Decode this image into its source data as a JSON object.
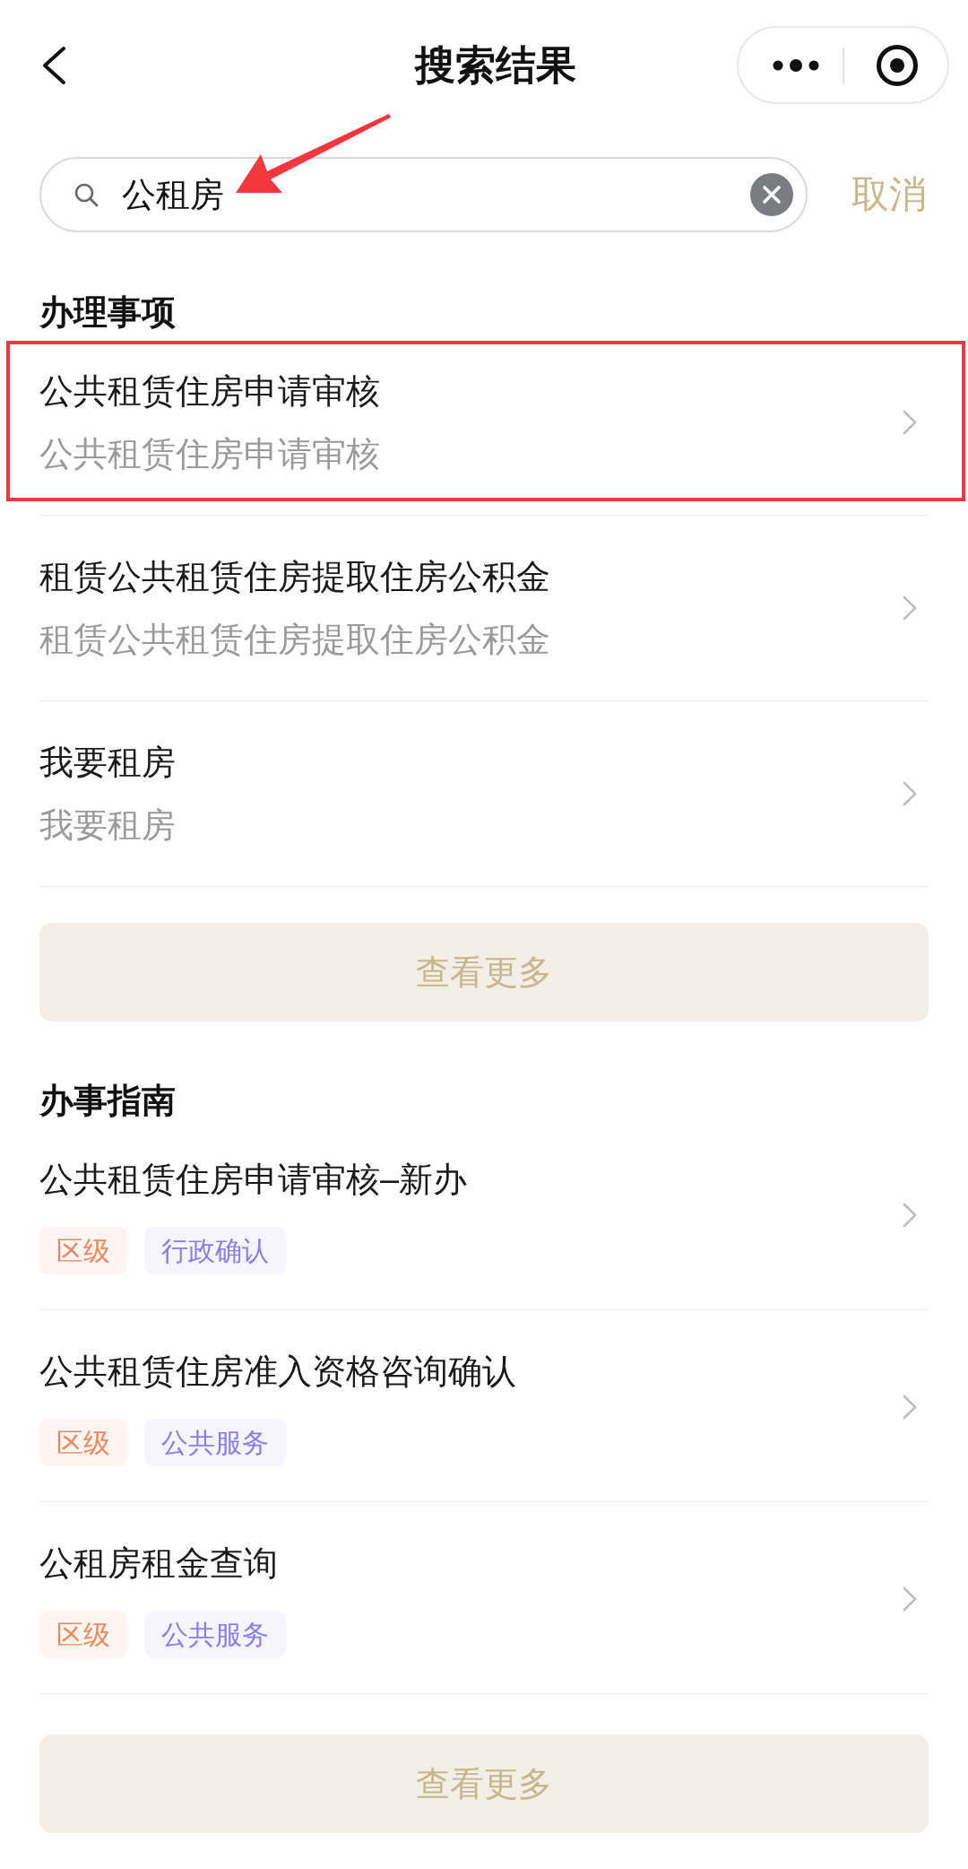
{
  "nav_bar": {
    "title": "搜索结果"
  },
  "search": {
    "value": "公租房",
    "pointed_at": true,
    "cancel": "取消"
  },
  "sections": [
    {
      "kind": "matters",
      "heading": "办理事项",
      "items": [
        {
          "title": "公共租赁住房申请审核",
          "subtitle": "公共租赁住房申请审核",
          "highlighted": true
        },
        {
          "title": "租赁公共租赁住房提取住房公积金",
          "subtitle": "租赁公共租赁住房提取住房公积金",
          "highlighted": false
        },
        {
          "title": "我要租房",
          "subtitle": "我要租房",
          "highlighted": false
        }
      ],
      "more": "查看更多"
    },
    {
      "kind": "guides",
      "heading": "办事指南",
      "items": [
        {
          "title": "公共租赁住房申请审核–新办",
          "tags": [
            {
              "label": "区级",
              "color": "#f0875a"
            },
            {
              "label": "行政确认",
              "color": "#8a7df0"
            }
          ]
        },
        {
          "title": "公共租赁住房准入资格咨询确认",
          "tags": [
            {
              "label": "区级",
              "color": "#f0875a"
            },
            {
              "label": "公共服务",
              "color": "#8a7df0"
            }
          ]
        },
        {
          "title": "公租房租金查询",
          "tags": [
            {
              "label": "区级",
              "color": "#f0875a"
            },
            {
              "label": "公共服务",
              "color": "#8a7df0"
            }
          ]
        }
      ],
      "more": "查看更多"
    }
  ]
}
